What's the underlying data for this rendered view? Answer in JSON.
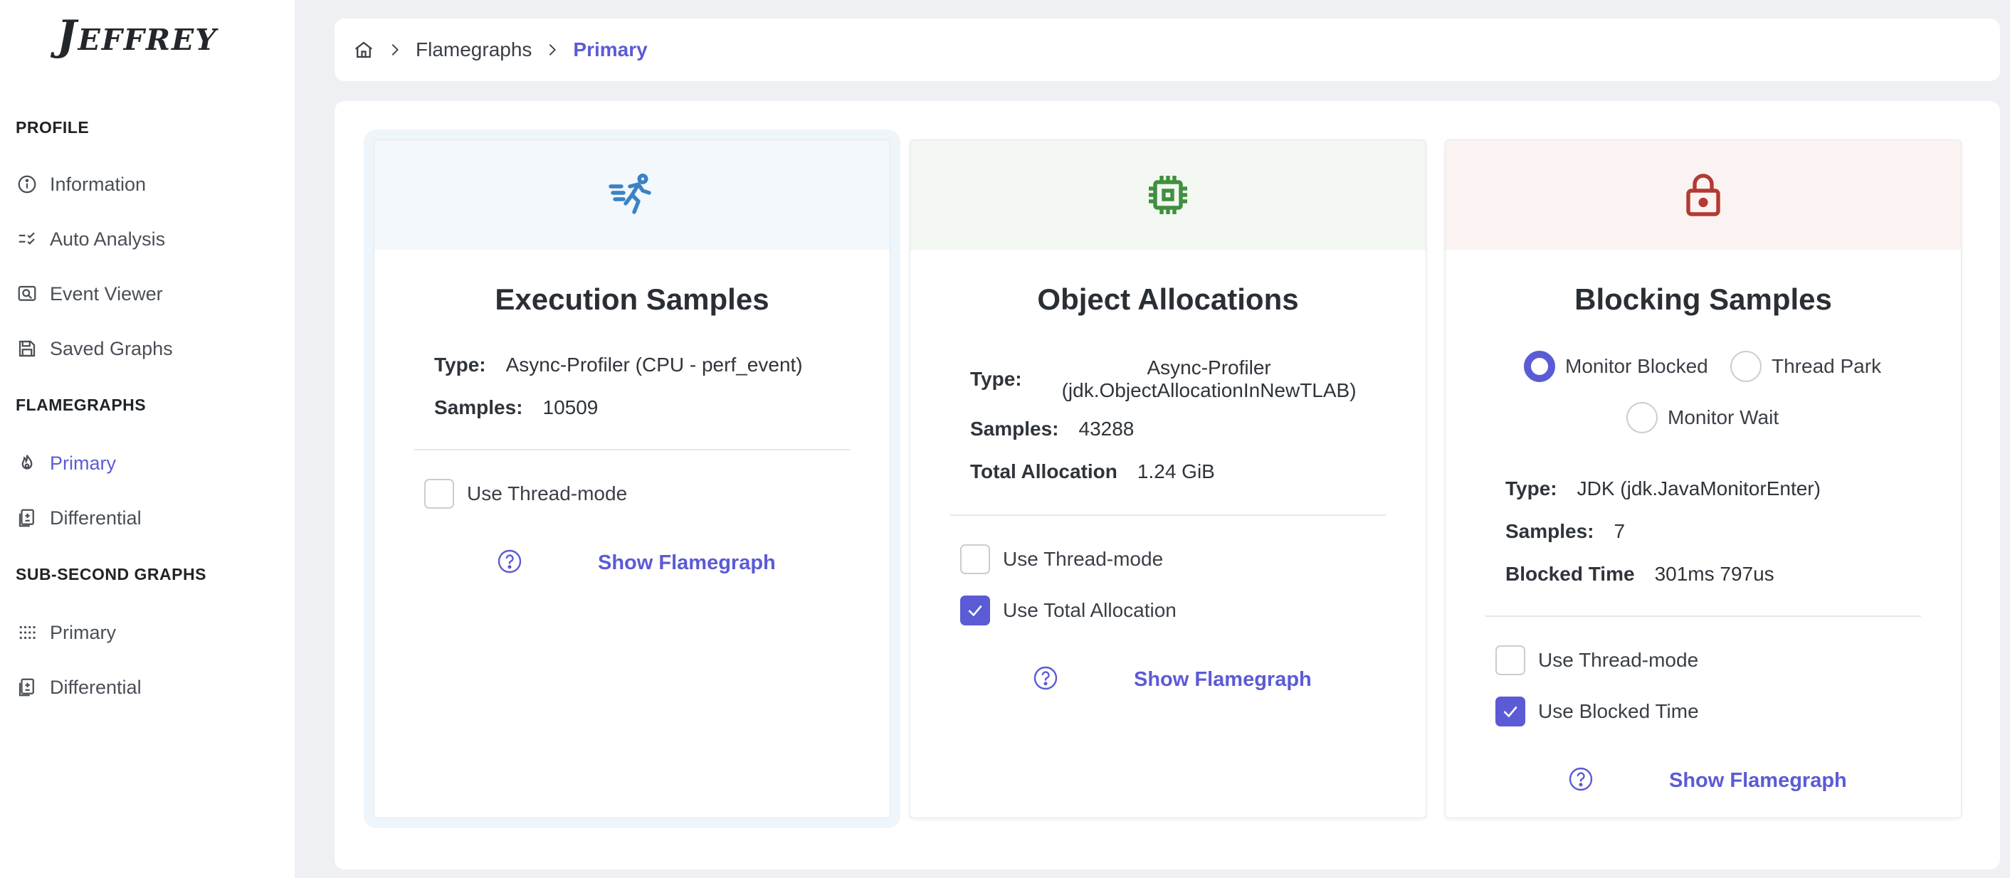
{
  "brand": "Jeffrey",
  "sidebar": {
    "sections": [
      {
        "title": "PROFILE",
        "items": [
          {
            "label": "Information",
            "icon": "info-circle-icon"
          },
          {
            "label": "Auto Analysis",
            "icon": "checklist-icon"
          },
          {
            "label": "Event Viewer",
            "icon": "search-image-icon"
          },
          {
            "label": "Saved Graphs",
            "icon": "floppy-disk-icon"
          }
        ]
      },
      {
        "title": "FLAMEGRAPHS",
        "items": [
          {
            "label": "Primary",
            "icon": "flame-icon",
            "active": true
          },
          {
            "label": "Differential",
            "icon": "file-diff-icon"
          }
        ]
      },
      {
        "title": "SUB-SECOND GRAPHS",
        "items": [
          {
            "label": "Primary",
            "icon": "grid-dots-icon"
          },
          {
            "label": "Differential",
            "icon": "file-diff-icon"
          }
        ]
      }
    ]
  },
  "breadcrumb": {
    "items": [
      "Flamegraphs",
      "Primary"
    ]
  },
  "cards": [
    {
      "title": "Execution Samples",
      "icon": "running-figure-icon",
      "type_label": "Type:",
      "type_value": "Async-Profiler (CPU - perf_event)",
      "samples_label": "Samples:",
      "samples_value": "10509",
      "options": [
        {
          "label": "Use Thread-mode",
          "checked": false
        }
      ],
      "show_label": "Show Flamegraph"
    },
    {
      "title": "Object Allocations",
      "icon": "cpu-chip-icon",
      "type_label": "Type:",
      "type_value_line1": "Async-Profiler",
      "type_value_line2": "(jdk.ObjectAllocationInNewTLAB)",
      "samples_label": "Samples:",
      "samples_value": "43288",
      "extra_label": "Total Allocation",
      "extra_value": "1.24 GiB",
      "options": [
        {
          "label": "Use Thread-mode",
          "checked": false
        },
        {
          "label": "Use Total Allocation",
          "checked": true
        }
      ],
      "show_label": "Show Flamegraph"
    },
    {
      "title": "Blocking Samples",
      "icon": "lock-icon",
      "radios": [
        {
          "label": "Monitor Blocked",
          "selected": true
        },
        {
          "label": "Thread Park",
          "selected": false
        },
        {
          "label": "Monitor Wait",
          "selected": false
        }
      ],
      "type_label": "Type:",
      "type_value": "JDK (jdk.JavaMonitorEnter)",
      "samples_label": "Samples:",
      "samples_value": "7",
      "extra_label": "Blocked Time",
      "extra_value": "301ms 797us",
      "options": [
        {
          "label": "Use Thread-mode",
          "checked": false
        },
        {
          "label": "Use Blocked Time",
          "checked": true
        }
      ],
      "show_label": "Show Flamegraph"
    }
  ],
  "colors": {
    "accent": "#5b5bd6",
    "exec_head": "#f3f8fc",
    "exec_icon": "#3b82c4",
    "alloc_head": "#f2f7f1",
    "alloc_icon": "#3f8f3f",
    "block_head": "#fbf3f2",
    "block_icon": "#b23a32"
  }
}
